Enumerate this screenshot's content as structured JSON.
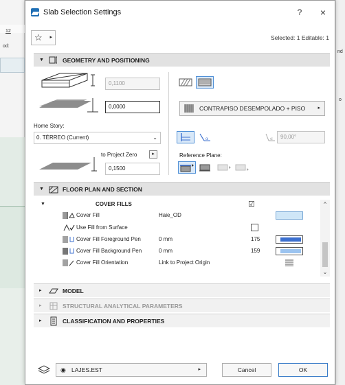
{
  "dialog": {
    "title": "Slab Selection Settings",
    "help_label": "?",
    "close_label": "×",
    "selected_info": "Selected: 1 Editable: 1",
    "fav_star": "☆",
    "fav_arrow": "▸"
  },
  "background": {
    "left_tab": "12",
    "left_label": "od:",
    "right_labels": [
      "nd",
      "o"
    ]
  },
  "geometry": {
    "header": "GEOMETRY AND POSITIONING",
    "thickness": "0,1100",
    "offset": "0,0000",
    "surface": "CONTRAPISO DESEMPOLADO + PISO",
    "surface_arrow": "▸",
    "home_story_label": "Home Story:",
    "home_story_value": "0. TÉRREO (Current)",
    "to_project_zero_label": "to Project Zero",
    "project_zero_value": "0,1500",
    "angle_value": "90,00°",
    "reference_plane_label": "Reference Plane:"
  },
  "floor_plan": {
    "header": "FLOOR PLAN AND SECTION",
    "group_label": "COVER FILLS",
    "group_checked": "☑",
    "rows": [
      {
        "name": "Cover Fill",
        "value": "Haie_OD",
        "num": ""
      },
      {
        "name": "Use Fill from Surface",
        "value": "",
        "num": ""
      },
      {
        "name": "Cover Fill Foreground Pen",
        "value": "0 mm",
        "num": "175"
      },
      {
        "name": "Cover Fill Background Pen",
        "value": "0 mm",
        "num": "159"
      },
      {
        "name": "Cover Fill Orientation",
        "value": "Link to Project Origin",
        "num": ""
      }
    ]
  },
  "panels": {
    "model": "MODEL",
    "structural": "STRUCTURAL ANALYTICAL PARAMETERS",
    "classification": "CLASSIFICATION AND PROPERTIES"
  },
  "footer": {
    "layer": "LAJES.EST",
    "layer_arrow": "▸",
    "cancel": "Cancel",
    "ok": "OK"
  },
  "colors": {
    "accent": "#4f8fd6",
    "fill_swatch": "#cfe6f7",
    "pen_fg": "#3b6fcf",
    "pen_bg": "#9cc4f0"
  }
}
